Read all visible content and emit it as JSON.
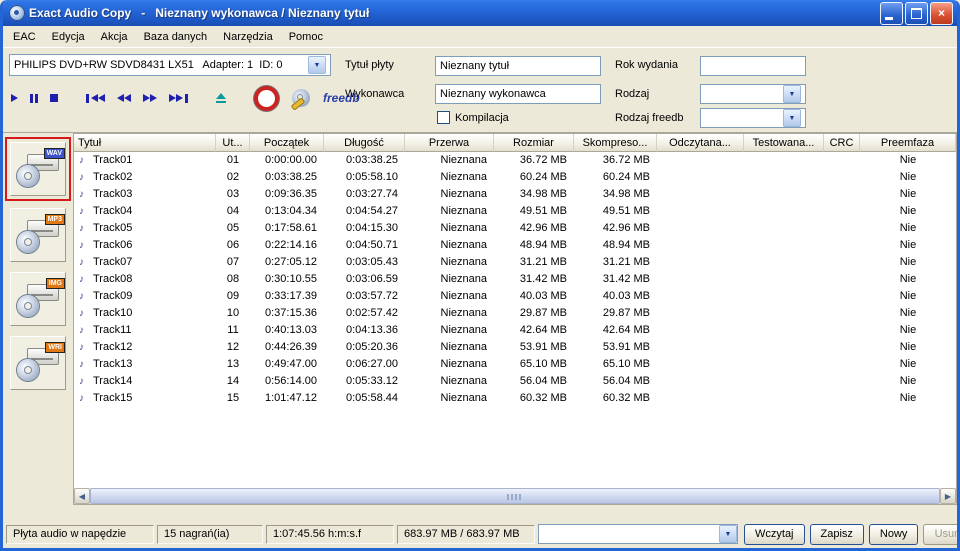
{
  "window": {
    "app_title": "Exact Audio Copy",
    "separator": "-",
    "doc_title": "Nieznany wykonawca / Nieznany tytuł"
  },
  "menu": {
    "items": [
      "EAC",
      "Edycja",
      "Akcja",
      "Baza danych",
      "Narzędzia",
      "Pomoc"
    ]
  },
  "drive": {
    "selected": "PHILIPS DVD+RW SDVD8431 LX51   Adapter: 1  ID: 0"
  },
  "cd_info": {
    "title_label": "Tytuł płyty",
    "title_value": "Nieznany tytuł",
    "artist_label": "Wykonawca",
    "artist_value": "Nieznany wykonawca",
    "year_label": "Rok wydania",
    "year_value": "",
    "genre_label": "Rodzaj",
    "genre_value": "",
    "freedb_genre_label": "Rodzaj freedb",
    "freedb_genre_value": "",
    "compilation_label": "Kompilacja",
    "compilation_checked": false
  },
  "transport": {
    "freedb_label": "freedb"
  },
  "sidebar": {
    "items": [
      {
        "label": "WAV",
        "selected": true,
        "badge_color": "#3b52c9"
      },
      {
        "label": "MP3",
        "selected": false,
        "badge_color": "#e07818"
      },
      {
        "label": "IMG",
        "selected": false,
        "badge_color": "#e07818"
      },
      {
        "label": "WRI",
        "selected": false,
        "badge_color": "#e07818"
      }
    ]
  },
  "table": {
    "columns": [
      "Tytuł",
      "Ut...",
      "Początek",
      "Długość",
      "Przerwa",
      "Rozmiar",
      "Skompreso...",
      "Odczytana...",
      "Testowana...",
      "CRC",
      "Preemfaza"
    ],
    "rows": [
      [
        "Track01",
        "01",
        "0:00:00.00",
        "0:03:38.25",
        "Nieznana",
        "36.72 MB",
        "36.72 MB",
        "",
        "",
        "",
        "Nie"
      ],
      [
        "Track02",
        "02",
        "0:03:38.25",
        "0:05:58.10",
        "Nieznana",
        "60.24 MB",
        "60.24 MB",
        "",
        "",
        "",
        "Nie"
      ],
      [
        "Track03",
        "03",
        "0:09:36.35",
        "0:03:27.74",
        "Nieznana",
        "34.98 MB",
        "34.98 MB",
        "",
        "",
        "",
        "Nie"
      ],
      [
        "Track04",
        "04",
        "0:13:04.34",
        "0:04:54.27",
        "Nieznana",
        "49.51 MB",
        "49.51 MB",
        "",
        "",
        "",
        "Nie"
      ],
      [
        "Track05",
        "05",
        "0:17:58.61",
        "0:04:15.30",
        "Nieznana",
        "42.96 MB",
        "42.96 MB",
        "",
        "",
        "",
        "Nie"
      ],
      [
        "Track06",
        "06",
        "0:22:14.16",
        "0:04:50.71",
        "Nieznana",
        "48.94 MB",
        "48.94 MB",
        "",
        "",
        "",
        "Nie"
      ],
      [
        "Track07",
        "07",
        "0:27:05.12",
        "0:03:05.43",
        "Nieznana",
        "31.21 MB",
        "31.21 MB",
        "",
        "",
        "",
        "Nie"
      ],
      [
        "Track08",
        "08",
        "0:30:10.55",
        "0:03:06.59",
        "Nieznana",
        "31.42 MB",
        "31.42 MB",
        "",
        "",
        "",
        "Nie"
      ],
      [
        "Track09",
        "09",
        "0:33:17.39",
        "0:03:57.72",
        "Nieznana",
        "40.03 MB",
        "40.03 MB",
        "",
        "",
        "",
        "Nie"
      ],
      [
        "Track10",
        "10",
        "0:37:15.36",
        "0:02:57.42",
        "Nieznana",
        "29.87 MB",
        "29.87 MB",
        "",
        "",
        "",
        "Nie"
      ],
      [
        "Track11",
        "11",
        "0:40:13.03",
        "0:04:13.36",
        "Nieznana",
        "42.64 MB",
        "42.64 MB",
        "",
        "",
        "",
        "Nie"
      ],
      [
        "Track12",
        "12",
        "0:44:26.39",
        "0:05:20.36",
        "Nieznana",
        "53.91 MB",
        "53.91 MB",
        "",
        "",
        "",
        "Nie"
      ],
      [
        "Track13",
        "13",
        "0:49:47.00",
        "0:06:27.00",
        "Nieznana",
        "65.10 MB",
        "65.10 MB",
        "",
        "",
        "",
        "Nie"
      ],
      [
        "Track14",
        "14",
        "0:56:14.00",
        "0:05:33.12",
        "Nieznana",
        "56.04 MB",
        "56.04 MB",
        "",
        "",
        "",
        "Nie"
      ],
      [
        "Track15",
        "15",
        "1:01:47.12",
        "0:05:58.44",
        "Nieznana",
        "60.32 MB",
        "60.32 MB",
        "",
        "",
        "",
        "Nie"
      ]
    ]
  },
  "statusbar": {
    "drive_status": "Płyta audio w napędzie",
    "track_count": "15 nagrań(ia)",
    "total_time": "1:07:45.56 h:m:s.f",
    "size_info": "683.97 MB / 683.97 MB",
    "buttons": [
      {
        "label": "Wczytaj",
        "enabled": true
      },
      {
        "label": "Zapisz",
        "enabled": true
      },
      {
        "label": "Nowy",
        "enabled": true
      },
      {
        "label": "Usuń",
        "enabled": false
      }
    ]
  }
}
